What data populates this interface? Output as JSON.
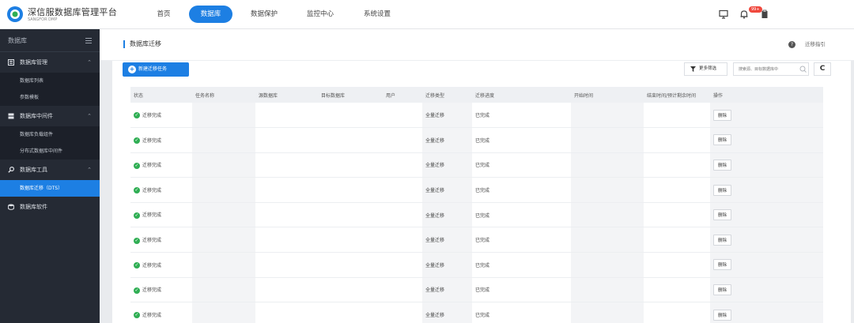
{
  "brand": {
    "name": "深信服数据库管理平台",
    "sub": "SANGFOR DMP"
  },
  "nav": [
    {
      "label": "首页",
      "active": false
    },
    {
      "label": "数据库",
      "active": true
    },
    {
      "label": "数据保护",
      "active": false
    },
    {
      "label": "监控中心",
      "active": false
    },
    {
      "label": "系统设置",
      "active": false
    }
  ],
  "notification_badge": "99+",
  "sidebar": {
    "title": "数据库",
    "groups": [
      {
        "label": "数据库管理",
        "icon": "database-manage-icon",
        "items": [
          {
            "label": "数据库列表"
          },
          {
            "label": "参数模板"
          }
        ]
      },
      {
        "label": "数据库中间件",
        "icon": "middleware-icon",
        "items": [
          {
            "label": "数据库负载组件"
          },
          {
            "label": "分布式数据库中间件"
          }
        ]
      },
      {
        "label": "数据库工具",
        "icon": "tool-icon",
        "items": [
          {
            "label": "数据库迁移（DTS）",
            "active": true
          }
        ]
      },
      {
        "label": "数据库软件",
        "icon": "software-icon",
        "items": []
      }
    ]
  },
  "page": {
    "title": "数据库迁移",
    "guide": "迁移指引",
    "new_button": "新建迁移任务",
    "filter_button": "更多筛选",
    "search_placeholder": "搜索源、目标数据库中",
    "refresh_icon": "C"
  },
  "table": {
    "columns": [
      "状态",
      "任务名称",
      "源数据库",
      "目标数据库",
      "用户",
      "迁移类型",
      "迁移进度",
      "开始时间",
      "结束时间/预计剩余时间",
      "操作"
    ],
    "rows": [
      {
        "status": "迁移完成",
        "name": "",
        "source": "",
        "target": "",
        "user": "",
        "type": "全量迁移",
        "progress": "已完成",
        "start": "",
        "end": "",
        "action": "删除"
      },
      {
        "status": "迁移完成",
        "name": "",
        "source": "",
        "target": "",
        "user": "",
        "type": "全量迁移",
        "progress": "已完成",
        "start": "",
        "end": "",
        "action": "删除"
      },
      {
        "status": "迁移完成",
        "name": "",
        "source": "",
        "target": "",
        "user": "",
        "type": "全量迁移",
        "progress": "已完成",
        "start": "",
        "end": "",
        "action": "删除"
      },
      {
        "status": "迁移完成",
        "name": "",
        "source": "",
        "target": "",
        "user": "",
        "type": "全量迁移",
        "progress": "已完成",
        "start": "",
        "end": "",
        "action": "删除"
      },
      {
        "status": "迁移完成",
        "name": "",
        "source": "",
        "target": "",
        "user": "",
        "type": "全量迁移",
        "progress": "已完成",
        "start": "",
        "end": "",
        "action": "删除"
      },
      {
        "status": "迁移完成",
        "name": "",
        "source": "",
        "target": "",
        "user": "",
        "type": "全量迁移",
        "progress": "已完成",
        "start": "",
        "end": "",
        "action": "删除"
      },
      {
        "status": "迁移完成",
        "name": "",
        "source": "",
        "target": "",
        "user": "",
        "type": "全量迁移",
        "progress": "已完成",
        "start": "",
        "end": "",
        "action": "删除"
      },
      {
        "status": "迁移完成",
        "name": "",
        "source": "",
        "target": "",
        "user": "",
        "type": "全量迁移",
        "progress": "已完成",
        "start": "",
        "end": "",
        "action": "删除"
      },
      {
        "status": "迁移完成",
        "name": "",
        "source": "",
        "target": "",
        "user": "",
        "type": "全量迁移",
        "progress": "已完成",
        "start": "",
        "end": "",
        "action": "删除"
      }
    ]
  },
  "colors": {
    "accent": "#1d7fe3",
    "sidebar": "#252a34",
    "success": "#2fae53",
    "badge": "#f0483d"
  }
}
